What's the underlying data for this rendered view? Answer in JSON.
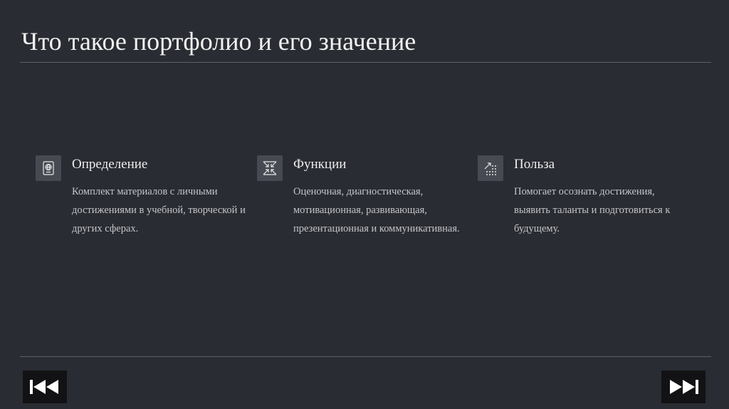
{
  "slide": {
    "title": "Что такое портфолио и его значение"
  },
  "cards": [
    {
      "title": "Определение",
      "text": "Комплект материалов с личными достижениями в учебной, творческой и других сферах.",
      "icon": "passport-icon"
    },
    {
      "title": "Функции",
      "text": "Оценочная, диагностическая, мотивационная, развивающая, презентационная и коммуникативная.",
      "icon": "arrows-inward-icon"
    },
    {
      "title": "Польза",
      "text": "Помогает осознать достижения, выявить таланты и подготовиться к будущему.",
      "icon": "growth-dots-icon"
    }
  ],
  "navigation": {
    "prev_icon": "skip-back-icon",
    "next_icon": "skip-forward-icon"
  },
  "colors": {
    "background": "#2a2c33",
    "icon_box": "#474a52",
    "divider": "#5d6068",
    "nav_button": "#121214"
  }
}
